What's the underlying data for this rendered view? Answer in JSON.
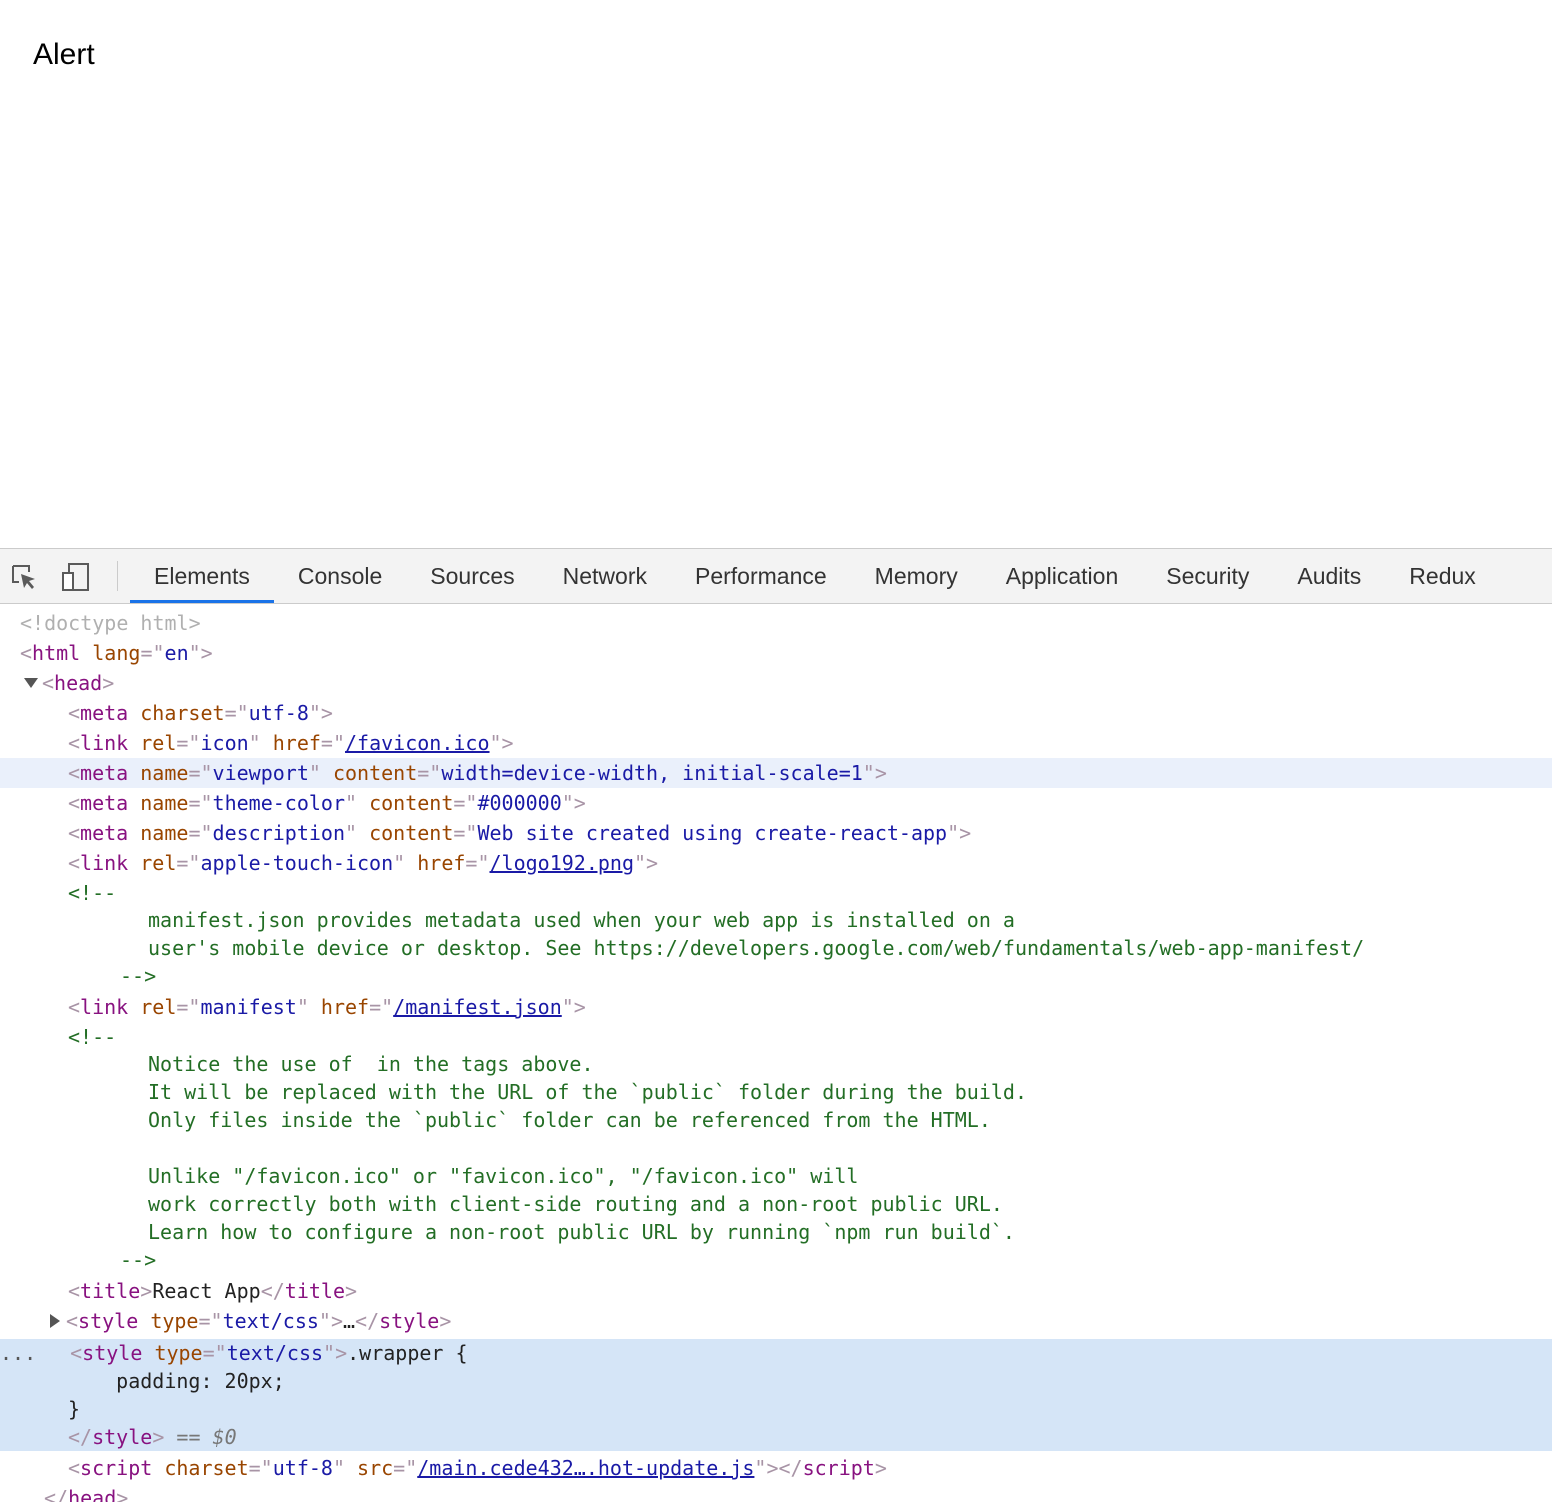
{
  "page": {
    "alert_text": "Alert"
  },
  "devtools": {
    "tabs": [
      {
        "label": "Elements",
        "active": true
      },
      {
        "label": "Console"
      },
      {
        "label": "Sources"
      },
      {
        "label": "Network"
      },
      {
        "label": "Performance"
      },
      {
        "label": "Memory"
      },
      {
        "label": "Application"
      },
      {
        "label": "Security"
      },
      {
        "label": "Audits"
      },
      {
        "label": "Redux"
      }
    ],
    "icons": {
      "inspect": "element-picker-icon",
      "device": "device-toolbar-icon"
    },
    "accent_color": "#1a73e8",
    "tree": {
      "doctype": "<!doctype html>",
      "html_open": {
        "tag": "html",
        "attr": "lang",
        "val": "en"
      },
      "head_tag": "head",
      "meta_charset": {
        "tag": "meta",
        "attr": "charset",
        "val": "utf-8"
      },
      "link_icon": {
        "tag": "link",
        "rel": "icon",
        "href": "/favicon.ico"
      },
      "meta_viewport": {
        "tag": "meta",
        "name": "viewport",
        "content": "width=device-width, initial-scale=1"
      },
      "meta_theme": {
        "tag": "meta",
        "name": "theme-color",
        "content": "#000000"
      },
      "meta_desc": {
        "tag": "meta",
        "name": "description",
        "content": "Web site created using create-react-app"
      },
      "link_apple": {
        "tag": "link",
        "rel": "apple-touch-icon",
        "href": "/logo192.png"
      },
      "comment1_open": "<!--",
      "comment1_lines": [
        "manifest.json provides metadata used when your web app is installed on a",
        "user's mobile device or desktop. See https://developers.google.com/web/fundamentals/web-app-manifest/"
      ],
      "comment_close": "-->",
      "link_manifest": {
        "tag": "link",
        "rel": "manifest",
        "href": "/manifest.json"
      },
      "comment2_lines": [
        "Notice the use of  in the tags above.",
        "It will be replaced with the URL of the `public` folder during the build.",
        "Only files inside the `public` folder can be referenced from the HTML.",
        "",
        "Unlike \"/favicon.ico\" or \"favicon.ico\", \"/favicon.ico\" will",
        "work correctly both with client-side routing and a non-root public URL.",
        "Learn how to configure a non-root public URL by running `npm run build`."
      ],
      "title": {
        "tag": "title",
        "text": "React App"
      },
      "style_collapsed": {
        "tag": "style",
        "type": "text/css",
        "ellipsis": "…"
      },
      "style_selected": {
        "tag": "style",
        "type": "text/css",
        "line1": ".wrapper {",
        "line2": "    padding: 20px;",
        "line3": "}",
        "marker": "== $0",
        "dots": "..."
      },
      "script": {
        "tag": "script",
        "charset": "utf-8",
        "src": "/main.cede432….hot-update.js"
      },
      "head_close": "head"
    }
  }
}
